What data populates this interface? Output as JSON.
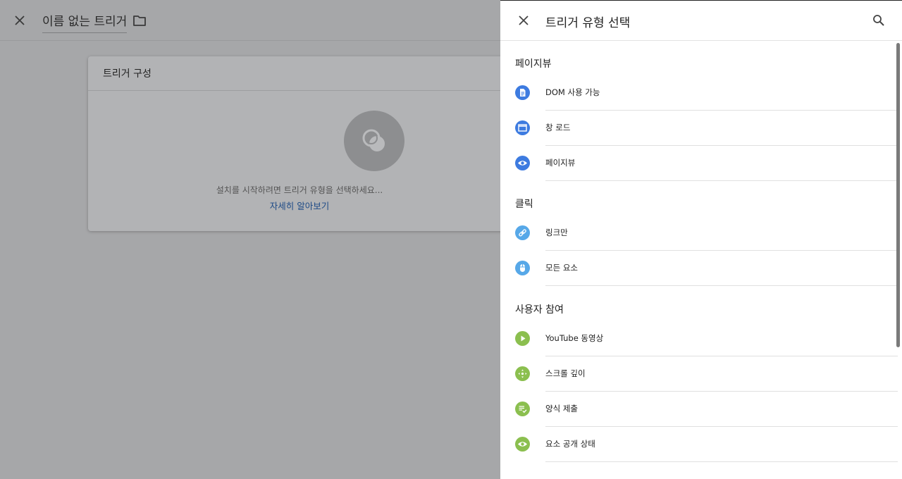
{
  "editor": {
    "title": "이름 없는 트리거",
    "card_title": "트리거 구성",
    "hint": "설치를 시작하려면 트리거 유형을 선택하세요...",
    "learn_more": "자세히 알아보기"
  },
  "panel": {
    "title": "트리거 유형 선택",
    "sections": [
      {
        "title": "페이지뷰",
        "items": [
          {
            "label": "DOM 사용 가능",
            "icon": "document-icon"
          },
          {
            "label": "창 로드",
            "icon": "window-icon"
          },
          {
            "label": "페이지뷰",
            "icon": "eye-icon"
          }
        ]
      },
      {
        "title": "클릭",
        "items": [
          {
            "label": "링크만",
            "icon": "link-icon"
          },
          {
            "label": "모든 요소",
            "icon": "mouse-icon"
          }
        ]
      },
      {
        "title": "사용자 참여",
        "items": [
          {
            "label": "YouTube 동영상",
            "icon": "play-icon"
          },
          {
            "label": "스크롤 깊이",
            "icon": "move-icon"
          },
          {
            "label": "양식 제출",
            "icon": "form-check-icon"
          },
          {
            "label": "요소 공개 상태",
            "icon": "eye-icon"
          }
        ]
      }
    ]
  },
  "colors": {
    "pageview_icon": "#3d7be0",
    "click_icon": "#57a8e8",
    "engagement_icon": "#8bbf4f",
    "link": "#1d4a86"
  }
}
